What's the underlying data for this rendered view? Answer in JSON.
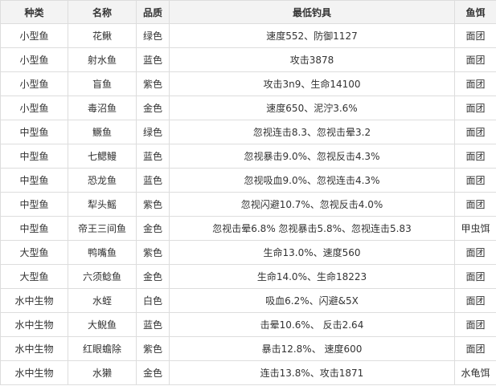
{
  "table": {
    "headers": [
      "种类",
      "名称",
      "品质",
      "最低钓具",
      "鱼饵"
    ],
    "rows": [
      [
        "小型鱼",
        "花鳅",
        "绿色",
        "速度552、防御1127",
        "面团"
      ],
      [
        "小型鱼",
        "射水鱼",
        "蓝色",
        "攻击3878",
        "面团"
      ],
      [
        "小型鱼",
        "盲鱼",
        "紫色",
        "攻击3n9、生命14100",
        "面团"
      ],
      [
        "小型鱼",
        "毒沼鱼",
        "金色",
        "速度650、泥泞3.6%",
        "面团"
      ],
      [
        "中型鱼",
        "鳜鱼",
        "绿色",
        "忽视连击8.3、忽视击晕3.2",
        "面团"
      ],
      [
        "中型鱼",
        "七鳃鳗",
        "蓝色",
        "忽视暴击9.0%、忽视反击4.3%",
        "面团"
      ],
      [
        "中型鱼",
        "恐龙鱼",
        "蓝色",
        "忽视吸血9.0%、忽视连击4.3%",
        "面团"
      ],
      [
        "中型鱼",
        "犁头鳐",
        "紫色",
        "忽视闪避10.7%、忽视反击4.0%",
        "面团"
      ],
      [
        "中型鱼",
        "帝王三间鱼",
        "金色",
        "忽视击晕6.8% 忽视暴击5.8%、忽视连击5.83",
        "甲虫饵"
      ],
      [
        "大型鱼",
        "鸭嘴鱼",
        "紫色",
        "生命13.0%、速度560",
        "面团"
      ],
      [
        "大型鱼",
        "六须鲶鱼",
        "金色",
        "生命14.0%、生命18223",
        "面团"
      ],
      [
        "水中生物",
        "水蛭",
        "白色",
        "吸血6.2%、闪避&5X",
        "面团"
      ],
      [
        "水中生物",
        "大鲵鱼",
        "蓝色",
        "击晕10.6%、 反击2.64",
        "面团"
      ],
      [
        "水中生物",
        "红眼蟾除",
        "紫色",
        "暴击12.8%、 速度600",
        "面团"
      ],
      [
        "水中生物",
        "水獭",
        "金色",
        "连击13.8%、攻击1871",
        "水龟饵"
      ]
    ]
  }
}
